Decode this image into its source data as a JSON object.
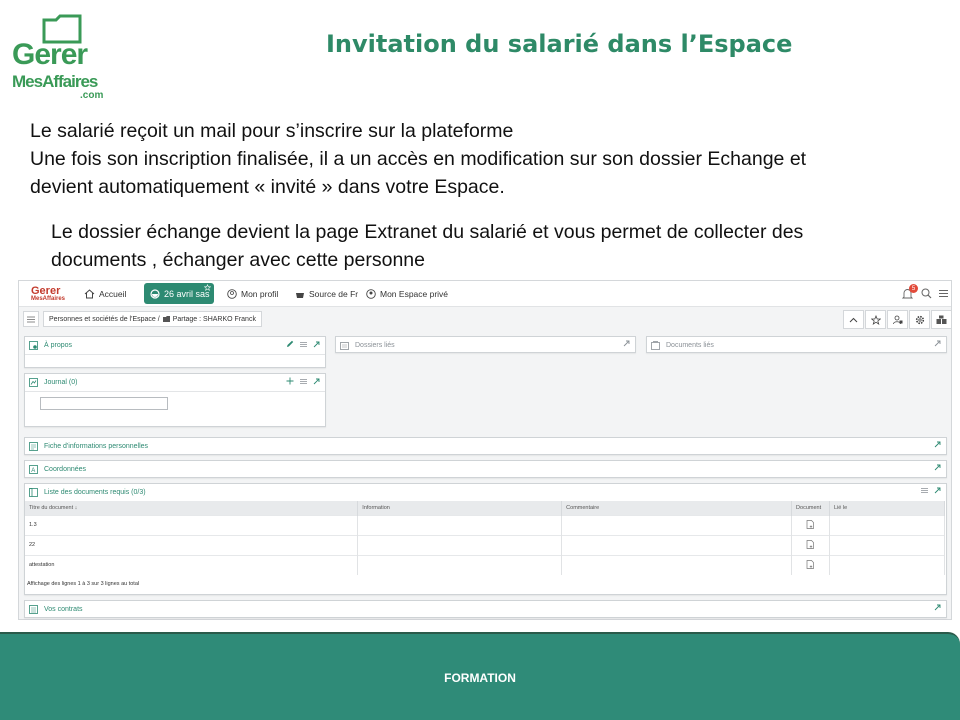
{
  "logo": {
    "line1": "Gerer",
    "line2": "MesAffaires",
    "line3": ".com"
  },
  "slide": {
    "title": "Invitation du salarié dans l’Espace",
    "paragraph1": [
      "Le salarié reçoit  un mail pour s’inscrire sur la plateforme",
      "Une fois son inscription finalisée, il  a un accès en modification sur son dossier Echange et",
      "devient automatiquement « invité » dans votre Espace."
    ],
    "paragraph2": [
      "Le dossier échange  devient la page Extranet du salarié et  vous permet de collecter des",
      "documents , échanger avec cette personne"
    ]
  },
  "app": {
    "logo": {
      "line1": "Gerer",
      "line2": "MesAffaires"
    },
    "nav": {
      "home": "Accueil",
      "date": "26 avril sas",
      "profile": "Mon profil",
      "source": "Source de Fr",
      "private_space": "Mon Espace privé",
      "notification_count": "5"
    },
    "breadcrumb": {
      "path": "Personnes et sociétés de l'Espace /",
      "current": "Partage : SHARKO Franck"
    },
    "panels": {
      "apropos": "À propos",
      "journal": "Journal (0)",
      "dossiers_lies": "Dossiers liés",
      "documents_lies": "Documents liés",
      "fiche": "Fiche d'informations personnelles",
      "coordonnees": "Coordonnées",
      "liste_docs": "Liste des documents requis (0/3)",
      "contrats": "Vos contrats"
    },
    "docs_table": {
      "columns": [
        "Titre du document ↓",
        "Information",
        "Commentaire",
        "Document",
        "Lié le"
      ],
      "rows": [
        {
          "title": "1.3",
          "information": "",
          "comment": "",
          "linked": ""
        },
        {
          "title": "22",
          "information": "",
          "comment": "",
          "linked": ""
        },
        {
          "title": "attestation",
          "information": "",
          "comment": "",
          "linked": ""
        }
      ],
      "footer": "Affichage des lignes 1 à 3 sur 3 lignes au total"
    }
  },
  "footer": {
    "label": "FORMATION"
  },
  "colors": {
    "brand_green": "#3a9a57",
    "teal": "#2d8a72",
    "footer": "#2f8b78",
    "logo_red": "#c33a2c"
  }
}
